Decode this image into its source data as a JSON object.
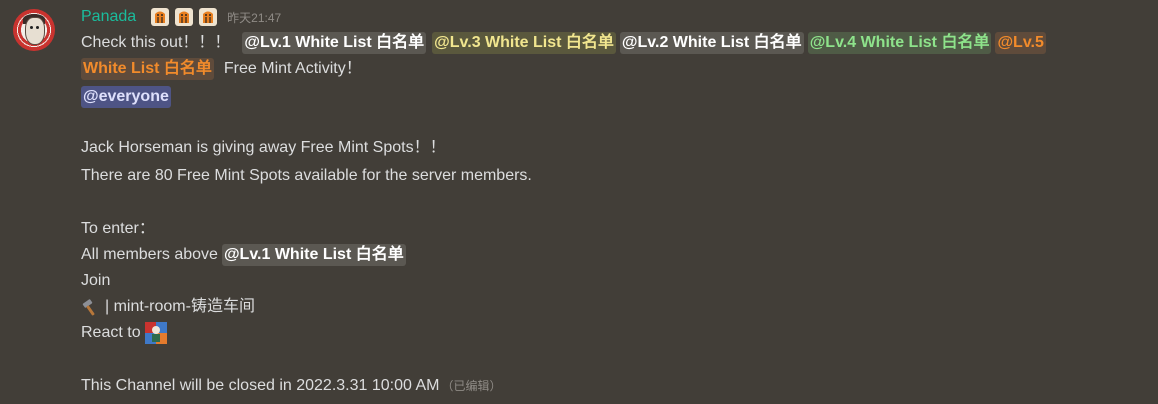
{
  "message": {
    "username": "Panada",
    "timestamp": "昨天21:47",
    "role_badges": [
      "horse-badge-icon",
      "horse-badge-icon",
      "horse-badge-icon"
    ],
    "line1": {
      "intro": "Check this out！！！",
      "mentions": [
        "@Lv.1 White List 白名单",
        "@Lv.3 White List 白名单",
        "@Lv.2 White List 白名单",
        "@Lv.4 White List 白名单"
      ],
      "wrap_start": "@Lv.5"
    },
    "line2": {
      "wrap_end": "White List 白名单",
      "outro": "Free Mint Activity！"
    },
    "everyone": "@everyone",
    "paragraph1": [
      "Jack Horseman is giving away Free Mint Spots！！",
      "There are 80 Free Mint Spots available for the  server members."
    ],
    "enter_title": "To enter：",
    "enter_items": {
      "members_prefix": "All members above",
      "members_role": "@Lv.1 White List 白名单",
      "join": "Join",
      "channel": "| mint-room-铸造车间",
      "react": "React to"
    },
    "closing": "This Channel will be closed in 2022.3.31 10:00 AM",
    "edited": "（已编辑）"
  },
  "colors": {
    "background": "#423e38",
    "username": "#1abc9c",
    "role_white": "#ffffff",
    "role_yellow": "#f1e68f",
    "role_green": "#8ee38b",
    "role_orange": "#f28b2b",
    "everyone": "#dee0fc"
  }
}
